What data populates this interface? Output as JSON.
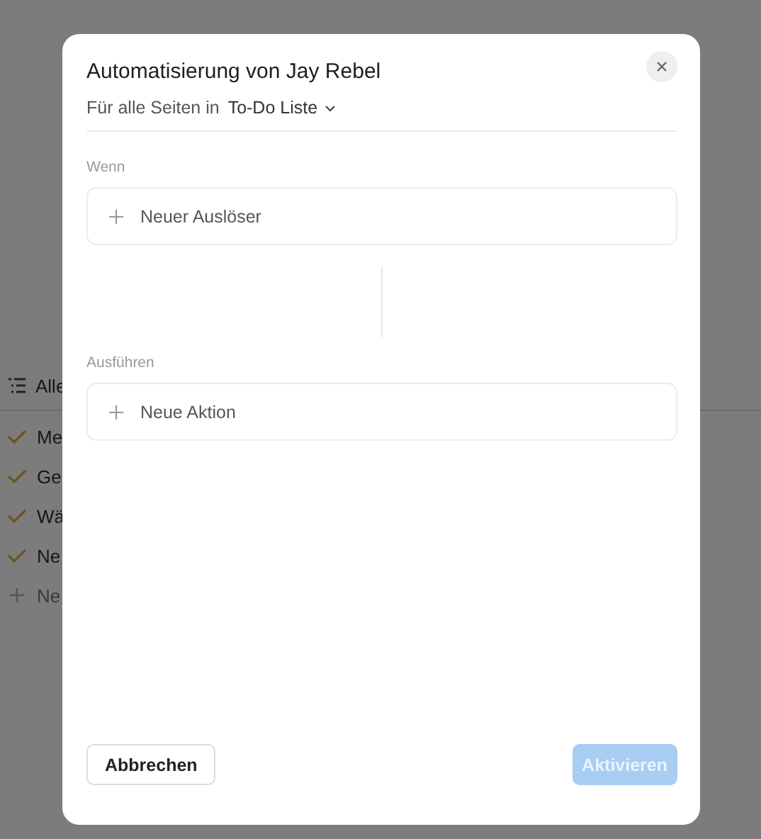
{
  "background": {
    "view_tab": "Alle",
    "items": [
      {
        "kind": "task",
        "label": "Me",
        "checked": true
      },
      {
        "kind": "task",
        "label": "Ge",
        "checked": true
      },
      {
        "kind": "task",
        "label": "Wä",
        "checked": true
      },
      {
        "kind": "task",
        "label": "Ne",
        "checked": true
      },
      {
        "kind": "new",
        "label": "Ne"
      }
    ]
  },
  "dialog": {
    "title": "Automatisierung von Jay Rebel",
    "scope_label": "Für alle Seiten in",
    "scope_value": "To-Do Liste",
    "sections": [
      {
        "label": "Wenn",
        "add_label": "Neuer Auslöser"
      },
      {
        "label": "Ausführen",
        "add_label": "Neue Aktion"
      }
    ],
    "cancel": "Abbrechen",
    "confirm": {
      "label": "Aktivieren",
      "disabled": true
    }
  }
}
